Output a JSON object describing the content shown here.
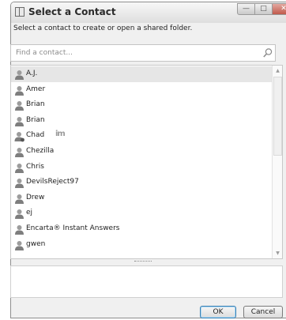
{
  "window": {
    "title": "Select a Contact",
    "controls": {
      "minimize_glyph": "—",
      "maximize_glyph": "□",
      "close_glyph": "✕"
    }
  },
  "instruction": "Select a contact to create or open a shared folder.",
  "search": {
    "placeholder": "Find a contact...",
    "value": "",
    "icon": "search-icon"
  },
  "contacts": [
    {
      "label": "A.J.",
      "icon": "contact-icon",
      "selected": true
    },
    {
      "label": "Amer",
      "icon": "contact-icon"
    },
    {
      "label": "Brian",
      "icon": "contact-icon"
    },
    {
      "label": "Brian",
      "icon": "contact-icon"
    },
    {
      "label": "Chad",
      "icon": "contact-online-icon",
      "badge": "im",
      "badge_icon": "windows-live-messenger-icon"
    },
    {
      "label": "Chezilla",
      "icon": "contact-icon"
    },
    {
      "label": "Chris",
      "icon": "contact-icon"
    },
    {
      "label": "DevilsReject97",
      "icon": "contact-icon"
    },
    {
      "label": "Drew",
      "icon": "contact-icon"
    },
    {
      "label": "ej",
      "icon": "contact-icon"
    },
    {
      "label": "Encarta® Instant Answers",
      "icon": "contact-icon"
    },
    {
      "label": "gwen",
      "icon": "contact-icon"
    }
  ],
  "buttons": {
    "ok_label": "OK",
    "cancel_label": "Cancel"
  },
  "colors": {
    "selected_row": "#e6e6e6",
    "close_button": "#c05a4c",
    "default_button_border": "#3c7fb1"
  }
}
